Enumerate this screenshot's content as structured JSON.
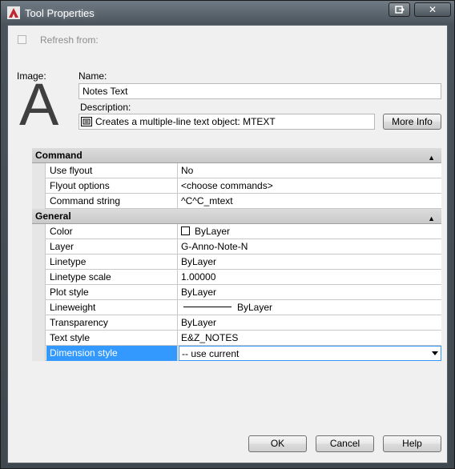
{
  "window": {
    "title": "Tool Properties",
    "controls": {
      "restore_icon": "restore-icon",
      "close_glyph": "✕"
    }
  },
  "refresh": {
    "label": "Refresh from:",
    "checked": false
  },
  "image_label": "Image:",
  "preview_glyph": "A",
  "name": {
    "label": "Name:",
    "value": "Notes Text"
  },
  "description": {
    "label": "Description:",
    "value": "Creates a multiple-line text object:  MTEXT"
  },
  "more_info_label": "More Info",
  "sections": [
    {
      "title": "Command",
      "rows": [
        {
          "key": "Use flyout",
          "value": "No"
        },
        {
          "key": "Flyout options",
          "value": "<choose commands>"
        },
        {
          "key": "Command string",
          "value": "^C^C_mtext"
        }
      ]
    },
    {
      "title": "General",
      "rows": [
        {
          "key": "Color",
          "value": "ByLayer"
        },
        {
          "key": "Layer",
          "value": "G-Anno-Note-N"
        },
        {
          "key": "Linetype",
          "value": "ByLayer"
        },
        {
          "key": "Linetype scale",
          "value": "1.00000"
        },
        {
          "key": "Plot style",
          "value": "ByLayer"
        },
        {
          "key": "Lineweight",
          "value": "ByLayer"
        },
        {
          "key": "Transparency",
          "value": "ByLayer"
        },
        {
          "key": "Text style",
          "value": "E&Z_NOTES"
        },
        {
          "key": "Dimension  style",
          "value": "-- use current"
        }
      ]
    }
  ],
  "buttons": {
    "ok": "OK",
    "cancel": "Cancel",
    "help": "Help"
  },
  "colors": {
    "selection": "#3399ff",
    "title_bar": "#4a535c"
  }
}
